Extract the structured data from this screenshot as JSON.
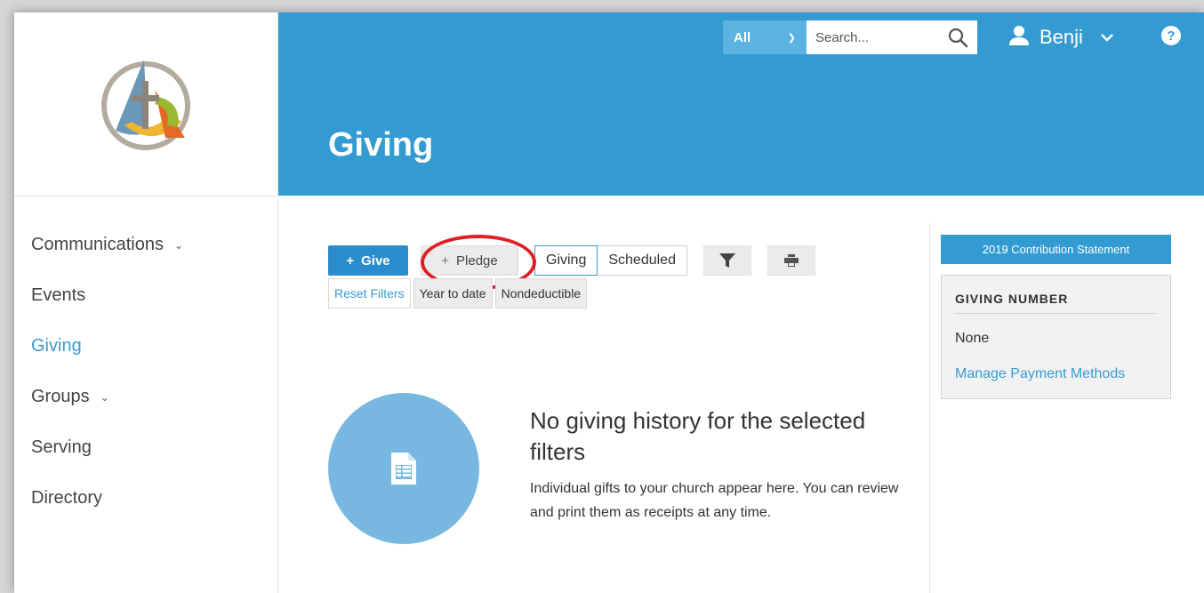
{
  "header": {
    "page_title": "Giving",
    "search_scope": "All",
    "search_placeholder": "Search...",
    "user_name": "Benji"
  },
  "sidebar": {
    "items": [
      {
        "label": "Communications",
        "has_submenu": true
      },
      {
        "label": "Events",
        "has_submenu": false
      },
      {
        "label": "Giving",
        "has_submenu": false,
        "active": true
      },
      {
        "label": "Groups",
        "has_submenu": true
      },
      {
        "label": "Serving",
        "has_submenu": false
      },
      {
        "label": "Directory",
        "has_submenu": false
      }
    ]
  },
  "toolbar": {
    "give_label": "Give",
    "pledge_label": "Pledge",
    "tabs": [
      {
        "label": "Giving",
        "active": true
      },
      {
        "label": "Scheduled",
        "active": false
      }
    ]
  },
  "filters": {
    "reset_label": "Reset Filters",
    "chips": [
      "Year to date",
      "Nondeductible"
    ]
  },
  "empty_state": {
    "title": "No giving history for the selected filters",
    "description": "Individual gifts to your church appear here. You can review and print them as receipts at any time."
  },
  "right_panel": {
    "statement_button": "2019 Contribution Statement",
    "giving_number_heading": "GIVING NUMBER",
    "giving_number_value": "None",
    "manage_link": "Manage Payment Methods"
  },
  "colors": {
    "header_blue": "#349bd2",
    "primary_button": "#2b8ccd",
    "link_blue": "#3a9bd1",
    "highlight_red": "#e01e24"
  },
  "icons": {
    "logo": "church-logo-cross",
    "search": "search-icon",
    "user": "user-icon",
    "help": "help-icon",
    "filter": "filter-icon",
    "print": "print-icon",
    "empty": "document-icon"
  }
}
